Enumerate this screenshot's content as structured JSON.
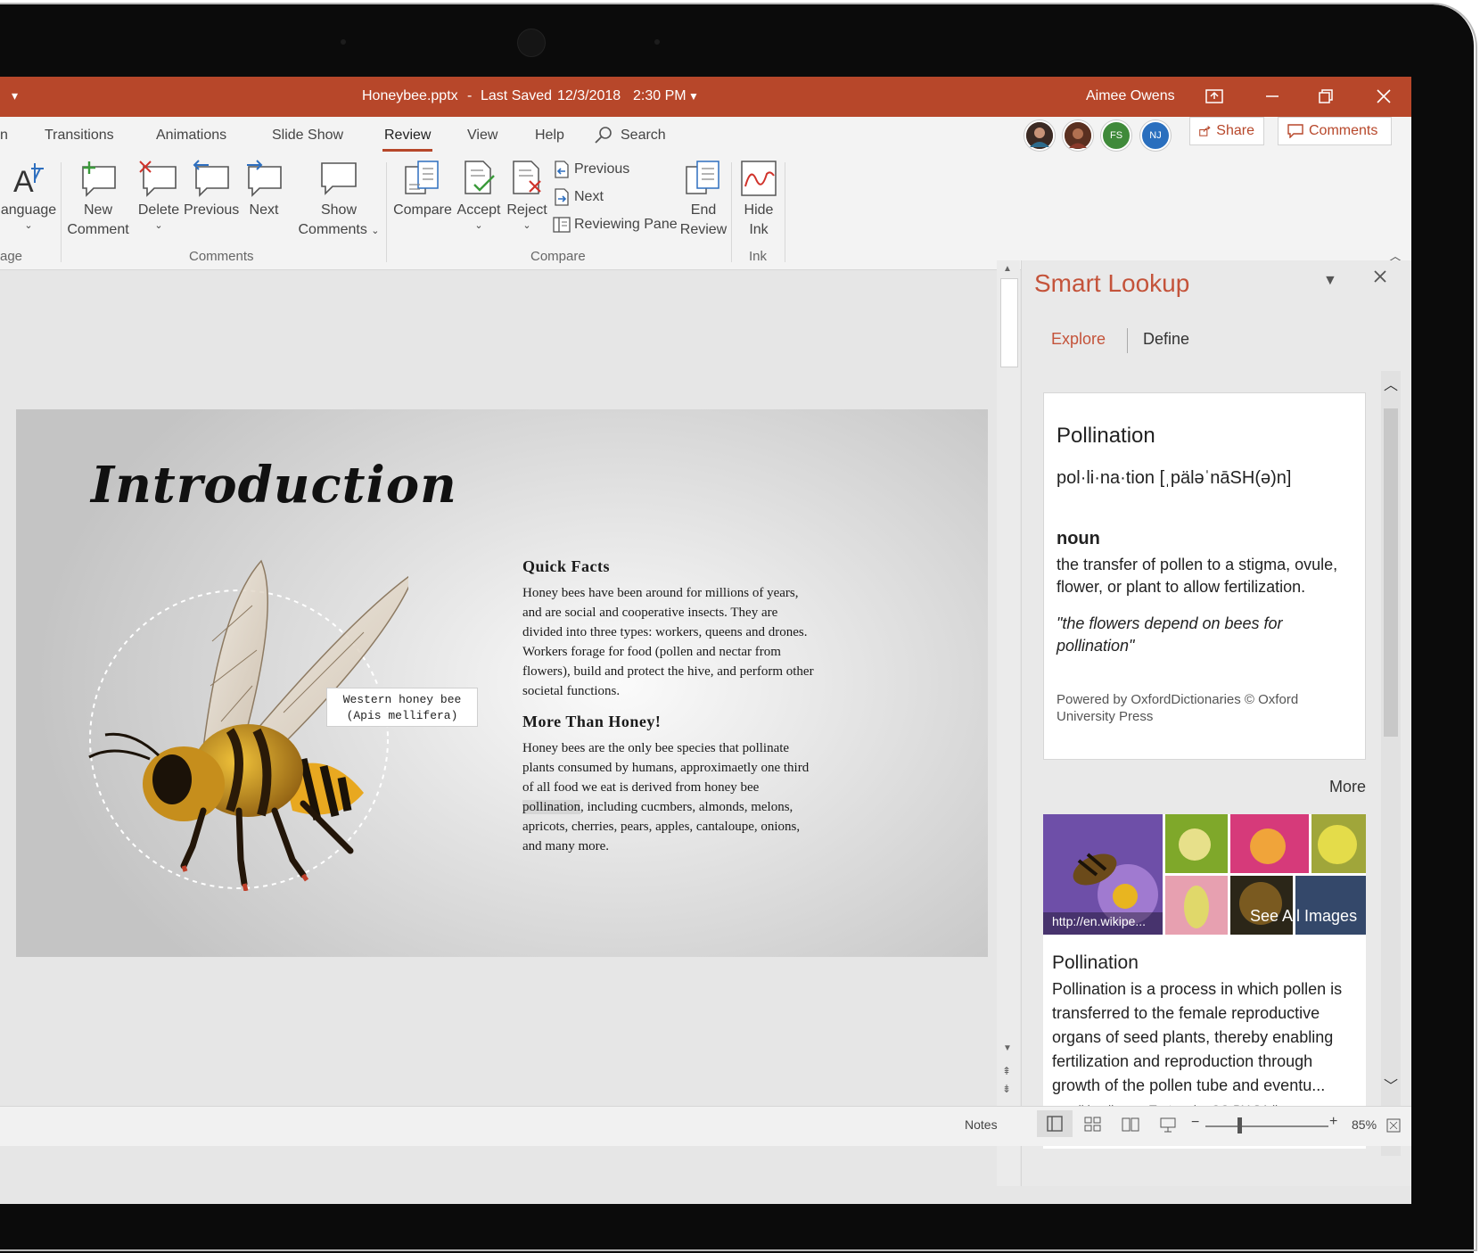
{
  "titlebar": {
    "menu_icon": "chevron-down-icon",
    "filename": "Honeybee.pptx",
    "separator": "-",
    "last_saved": "Last Saved",
    "date": "12/3/2018",
    "time": "2:30 PM",
    "user": "Aimee Owens",
    "bg_color": "#b7472a"
  },
  "tabs": [
    {
      "label": "n"
    },
    {
      "label": "Transitions"
    },
    {
      "label": "Animations"
    },
    {
      "label": "Slide Show"
    },
    {
      "label": "Review"
    },
    {
      "label": "View"
    },
    {
      "label": "Help"
    }
  ],
  "search": {
    "label": "Search"
  },
  "collaborators": {
    "avatar3": "FS",
    "avatar4": "NJ",
    "share": "Share",
    "comments": "Comments"
  },
  "ribbon": {
    "language": {
      "label": "anguage",
      "group": "age"
    },
    "new_comment": {
      "line1": "New",
      "line2": "Comment"
    },
    "delete": {
      "label": "Delete"
    },
    "previous": {
      "label": "Previous"
    },
    "next": {
      "label": "Next"
    },
    "show_comments": {
      "line1": "Show",
      "line2": "Comments"
    },
    "comments_group": "Comments",
    "compare": {
      "label": "Compare"
    },
    "accept": {
      "label": "Accept"
    },
    "reject": {
      "label": "Reject"
    },
    "compare_previous": "Previous",
    "compare_next": "Next",
    "reviewing_pane": "Reviewing Pane",
    "end_review": {
      "line1": "End",
      "line2": "Review"
    },
    "compare_group": "Compare",
    "hide_ink": {
      "line1": "Hide",
      "line2": "Ink"
    },
    "ink_group": "Ink"
  },
  "slide": {
    "title": "Introduction",
    "image_label_line1": "Western honey bee",
    "image_label_line2": "(Apis mellifera)",
    "quick_facts_heading": "Quick Facts",
    "quick_facts_lines": [
      "Honey bees have been around for millions of years,",
      "and are social and cooperative insects. They are",
      "divided into three types: workers, queens and drones.",
      "Workers forage for food (pollen and nectar from",
      "flowers), build and protect the hive, and perform other",
      "societal functions."
    ],
    "more_heading": "More Than Honey!",
    "more_line1": "Honey bees are the only bee species that pollinate",
    "more_line2": "plants consumed by humans, approximaetly one third",
    "more_line3": "of all food we eat is derived from honey bee",
    "more_highlight": "pollination",
    "more_line4_rest": ", including cucmbers, almonds, melons,",
    "more_line5": "apricots, cherries, pears, apples, cantaloupe, onions,",
    "more_line6": "and many more."
  },
  "smart_lookup": {
    "title": "Smart Lookup",
    "tab_explore": "Explore",
    "tab_define": "Define",
    "word": "Pollination",
    "pronunciation": "pol·li·na·tion [ˌpäləˈnāSH(ə)n]",
    "pos": "noun",
    "definition": "the transfer of pollen to a stigma, ovule, flower, or plant to allow fertilization.",
    "example": "\"the flowers depend on bees for pollination\"",
    "attribution": "Powered by OxfordDictionaries © Oxford University Press",
    "more": "More",
    "image_source": "http://en.wikipe...",
    "see_all": "See All Images",
    "wiki_title": "Pollination",
    "wiki_text": "Pollination is a process in which pollen is transferred to the female reproductive organs of seed plants, thereby enabling fertilization and reproduction through growth of the pollen tube and eventu...",
    "wiki_source": "en.wikipedia.org",
    "wiki_license": "Text under CC-BY-SA license",
    "accent_color": "#c4533a"
  },
  "statusbar": {
    "notes": "Notes",
    "zoom": "85%",
    "zoom_level": 0.85
  }
}
